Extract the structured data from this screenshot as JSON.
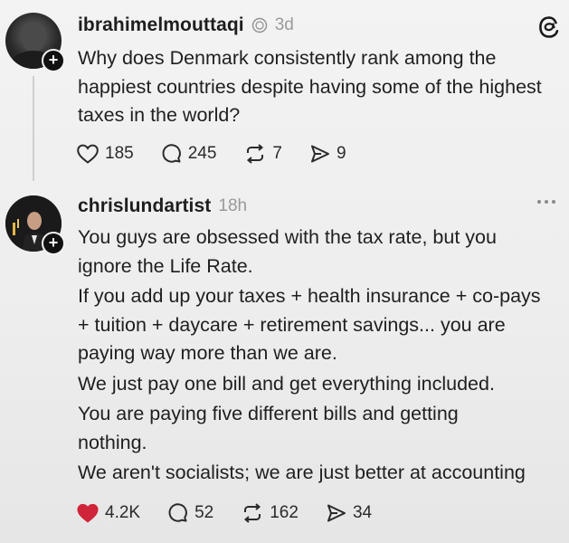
{
  "posts": [
    {
      "username": "ibrahimelmouttaqi",
      "time": "3d",
      "paragraphs": [
        "Why does Denmark consistently rank among the happiest countries despite having some of the highest taxes in the world?"
      ],
      "likes": "185",
      "comments": "245",
      "reposts": "7",
      "shares": "9",
      "liked": false
    },
    {
      "username": "chrislundartist",
      "time": "18h",
      "paragraphs": [
        "You guys are obsessed with the tax rate, but you ignore the Life Rate.",
        "If you add up your taxes + health insurance + co-pays + tuition + daycare + retirement savings... you are paying way more than we are.",
        "We just pay one bill and get everything included.",
        "You are paying five different bills and getting nothing.",
        "We aren't socialists; we are just better at accounting"
      ],
      "likes": "4.2K",
      "comments": "52",
      "reposts": "162",
      "shares": "34",
      "liked": true
    }
  ],
  "icons": {
    "plus": "+",
    "heart_color": "#d0243a",
    "logo": "threads-logo-icon"
  }
}
